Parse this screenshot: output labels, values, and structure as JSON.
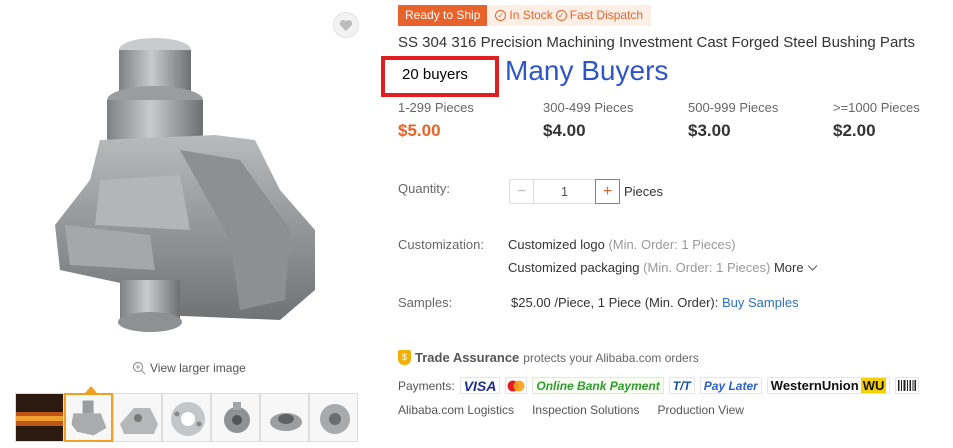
{
  "gallery": {
    "view_larger_label": "View larger image",
    "thumbnails": [
      "thumb-furnace",
      "thumb-bushing-main",
      "thumb-bracket",
      "thumb-flange",
      "thumb-valve-body",
      "thumb-ring",
      "thumb-hub"
    ]
  },
  "badges": {
    "ready_to_ship": "Ready to Ship",
    "in_stock": "In Stock",
    "fast_dispatch": "Fast Dispatch"
  },
  "product": {
    "title": "SS 304 316 Precision Machining Investment Cast Forged Steel Bushing Parts",
    "buyers": "20 buyers",
    "annotation": "Many Buyers"
  },
  "tiers": [
    {
      "range": "1-299 Pieces",
      "price": "$5.00"
    },
    {
      "range": "300-499 Pieces",
      "price": "$4.00"
    },
    {
      "range": "500-999 Pieces",
      "price": "$3.00"
    },
    {
      "range": ">=1000 Pieces",
      "price": "$2.00"
    }
  ],
  "quantity": {
    "label": "Quantity:",
    "value": "1",
    "unit": "Pieces",
    "minus": "−",
    "plus": "+"
  },
  "customization": {
    "label": "Customization:",
    "logo": "Customized logo",
    "logo_min": "(Min. Order: 1 Pieces)",
    "packaging": "Customized packaging",
    "packaging_min": "(Min. Order: 1 Pieces)",
    "more": "More"
  },
  "samples": {
    "label": "Samples:",
    "value": "$25.00 /Piece, 1 Piece (Min. Order):",
    "link": "Buy Samples"
  },
  "trade_assurance": {
    "title": "Trade Assurance",
    "text": "protects your Alibaba.com orders"
  },
  "payments": {
    "label": "Payments:",
    "methods": [
      "VISA",
      "Online Bank Payment",
      "T/T",
      "Pay Later",
      "WesternUnion",
      "WU"
    ]
  },
  "services": [
    "Alibaba.com Logistics",
    "Inspection Solutions",
    "Production View"
  ],
  "colors": {
    "accent": "#e8632b",
    "annotation_red": "#e02020",
    "annotation_blue": "#2e55c8",
    "link": "#2a71c4"
  }
}
